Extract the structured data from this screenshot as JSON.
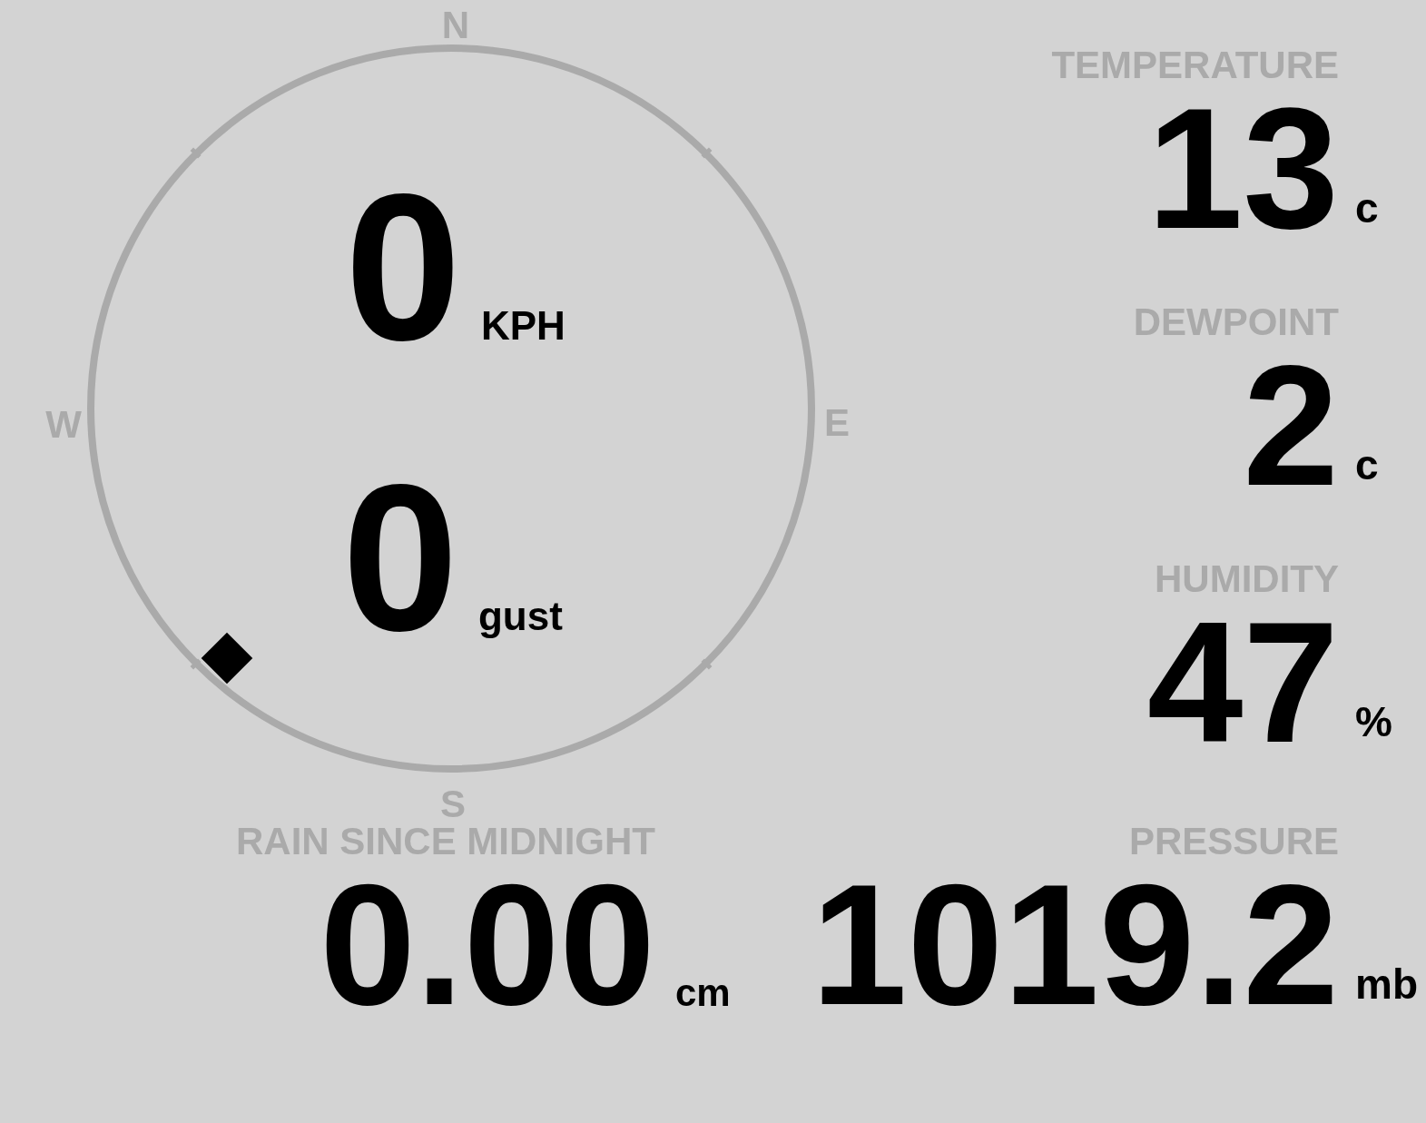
{
  "compass": {
    "north": "N",
    "east": "E",
    "south": "S",
    "west": "W"
  },
  "wind": {
    "speed": "0",
    "speed_unit": "KPH",
    "gust": "0",
    "gust_unit": "gust"
  },
  "stats": [
    {
      "label": "TEMPERATURE",
      "value": "13",
      "unit": "c"
    },
    {
      "label": "DEWPOINT",
      "value": "2",
      "unit": "c"
    },
    {
      "label": "HUMIDITY",
      "value": "47",
      "unit": "%"
    }
  ],
  "rain": {
    "label": "RAIN SINCE MIDNIGHT",
    "value": "0.00",
    "unit": "cm"
  },
  "pressure": {
    "label": "PRESSURE",
    "value": "1019.2",
    "unit": "mb"
  }
}
